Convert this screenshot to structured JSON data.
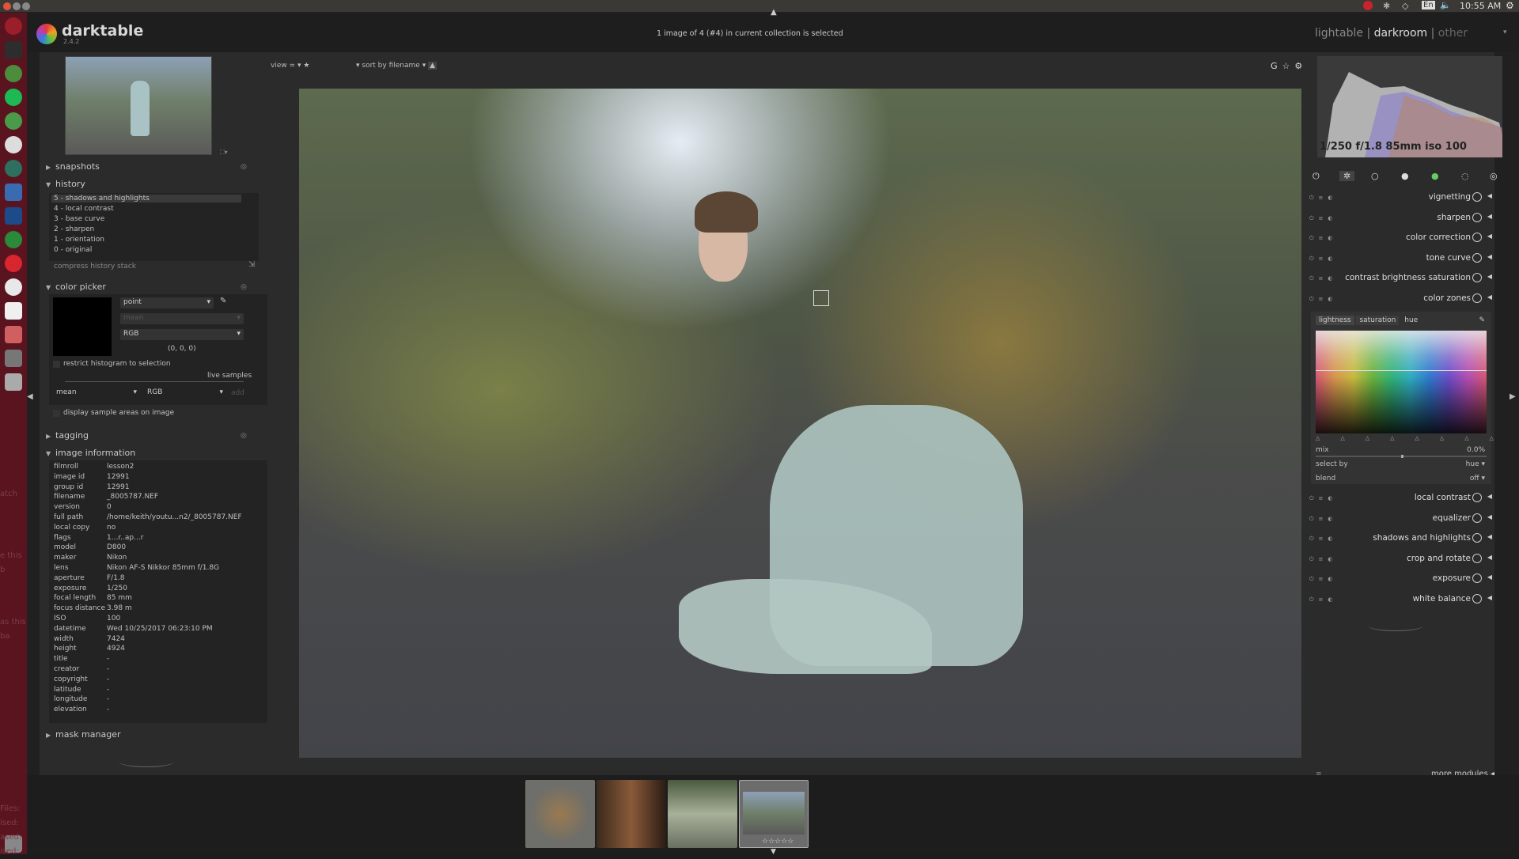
{
  "topbar": {
    "language": "En",
    "time": "10:55 AM"
  },
  "app": {
    "name": "darktable",
    "version": "2.4.2"
  },
  "header": {
    "status": "1 image of 4 (#4) in current collection is selected",
    "views": [
      "lightable",
      "darkroom",
      "other"
    ],
    "view_sep": "|"
  },
  "toolbar": {
    "view_label": "view",
    "view_op": "=",
    "sort_label": "sort by",
    "sort_value": "filename"
  },
  "snapshots": {
    "title": "snapshots"
  },
  "history": {
    "title": "history",
    "items": [
      "5 - shadows and highlights",
      "4 - local contrast",
      "3 - base curve",
      "2 - sharpen",
      "1 - orientation",
      "0 - original"
    ],
    "compress": "compress history stack"
  },
  "color_picker": {
    "title": "color picker",
    "mode": "point",
    "stat": "mean",
    "model": "RGB",
    "value": "(0, 0, 0)",
    "restrict": "restrict histogram to selection",
    "live": "live samples",
    "sample_stat": "mean",
    "sample_model": "RGB",
    "add": "add",
    "display": "display sample areas on image"
  },
  "tagging": {
    "title": "tagging"
  },
  "image_info": {
    "title": "image information",
    "rows": [
      [
        "filmroll",
        "lesson2"
      ],
      [
        "image id",
        "12991"
      ],
      [
        "group id",
        "12991"
      ],
      [
        "filename",
        "_8005787.NEF"
      ],
      [
        "version",
        "0"
      ],
      [
        "full path",
        "/home/keith/youtu...n2/_8005787.NEF"
      ],
      [
        "local copy",
        "no"
      ],
      [
        "flags",
        "1...r..ap...r"
      ],
      [
        "model",
        "D800"
      ],
      [
        "maker",
        "Nikon"
      ],
      [
        "lens",
        "Nikon AF-S Nikkor 85mm f/1.8G"
      ],
      [
        "aperture",
        "F/1.8"
      ],
      [
        "exposure",
        "1/250"
      ],
      [
        "focal length",
        "85 mm"
      ],
      [
        "focus distance",
        "3.98 m"
      ],
      [
        "ISO",
        "100"
      ],
      [
        "datetime",
        "Wed 10/25/2017 06:23:10 PM"
      ],
      [
        "width",
        "7424"
      ],
      [
        "height",
        "4924"
      ],
      [
        "title",
        "-"
      ],
      [
        "creator",
        "-"
      ],
      [
        "copyright",
        "-"
      ],
      [
        "latitude",
        "-"
      ],
      [
        "longitude",
        "-"
      ],
      [
        "elevation",
        "-"
      ]
    ]
  },
  "mask_manager": {
    "title": "mask manager"
  },
  "histogram": {
    "exif": "1/250 f/1.8 85mm iso 100"
  },
  "modules": [
    {
      "name": "vignetting"
    },
    {
      "name": "sharpen"
    },
    {
      "name": "color correction"
    },
    {
      "name": "tone curve"
    },
    {
      "name": "contrast brightness saturation"
    },
    {
      "name": "color zones"
    }
  ],
  "color_zones": {
    "tabs": [
      "lightness",
      "saturation",
      "hue"
    ],
    "mix_label": "mix",
    "mix_value": "0.0%",
    "mix_fraction": 0.5,
    "select_by_label": "select by",
    "select_by_value": "hue",
    "blend_label": "blend",
    "blend_value": "off"
  },
  "modules2": [
    {
      "name": "local contrast"
    },
    {
      "name": "equalizer"
    },
    {
      "name": "shadows and highlights"
    },
    {
      "name": "crop and rotate"
    },
    {
      "name": "exposure"
    },
    {
      "name": "white balance"
    }
  ],
  "more_modules": "more modules",
  "left_edge_fragments": [
    "atch",
    "e this b",
    "as this ba",
    "Files:",
    "ised:",
    "ased:",
    "ised:",
    "ised:"
  ],
  "colors": {
    "accent": "#c8c8c8",
    "panel": "#2b2b2b",
    "header": "#1e1e1e",
    "launcher": "#5a1420"
  }
}
